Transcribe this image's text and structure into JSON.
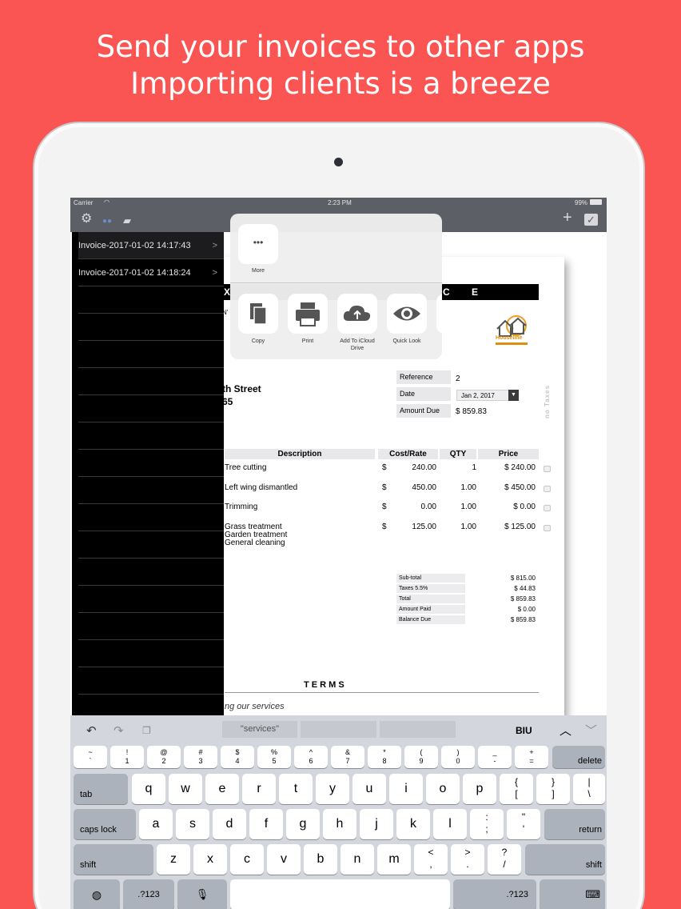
{
  "headline": {
    "line1": "Send your invoices to other apps",
    "line2": "Importing clients is a breeze"
  },
  "status": {
    "carrier": "Carrier",
    "time": "2:23 PM",
    "battery": "99%"
  },
  "nav": {
    "add": "+",
    "done": "✓"
  },
  "invoices": [
    {
      "label": "Invoice-2017-01-02 14:17:43",
      "chev": ">"
    },
    {
      "label": "Invoice-2017-01-02 14:18:24",
      "chev": ">"
    }
  ],
  "share": {
    "more_dots": "•••",
    "more": "More",
    "copy": "Copy",
    "print": "Print",
    "icloud_l1": "Add To iCloud",
    "icloud_l2": "Drive",
    "quicklook": "Quick Look"
  },
  "doc": {
    "bar_left": "X",
    "bar_right": "C E",
    "frag_n": "N'",
    "street": "th Street",
    "zip": "65",
    "logo_text": "Houseline",
    "reference_label": "Reference",
    "reference_value": "2",
    "date_label": "Date",
    "date_value": "Jan 2, 2017",
    "due_label": "Amount Due",
    "due_value": "$ 859.83",
    "vertical": "no Taxes",
    "headers": {
      "description": "Description",
      "cost": "Cost/Rate",
      "qty": "QTY",
      "price": "Price"
    },
    "items": [
      {
        "desc": "Tree cutting",
        "currency": "$",
        "cost": "240.00",
        "qty": "1",
        "price": "$ 240.00"
      },
      {
        "desc": "Left wing dismantled",
        "currency": "$",
        "cost": "450.00",
        "qty": "1.00",
        "price": "$ 450.00"
      },
      {
        "desc": "Trimming",
        "currency": "$",
        "cost": "0.00",
        "qty": "1.00",
        "price": "$ 0.00"
      },
      {
        "desc": "Grass treatment",
        "desc2": "Garden treatment",
        "desc3": "General cleaning",
        "currency": "$",
        "cost": "125.00",
        "qty": "1.00",
        "price": "$ 125.00"
      }
    ],
    "totals": [
      {
        "label": "Sub-total",
        "value": "$ 815.00"
      },
      {
        "label": "Taxes 5.5%",
        "value": "$ 44.83"
      },
      {
        "label": "Total",
        "value": "$ 859.83"
      },
      {
        "label": "Amount Paid",
        "value": "$ 0.00"
      },
      {
        "label": "Balance Due",
        "value": "$ 859.83"
      }
    ],
    "terms": "T E R M S",
    "terms_text": "ng our services"
  },
  "keyboard": {
    "suggestion": "\"services\"",
    "biu": "BIU",
    "row_num": [
      {
        "top": "~",
        "bottom": "`"
      },
      {
        "top": "!",
        "bottom": "1"
      },
      {
        "top": "@",
        "bottom": "2"
      },
      {
        "top": "#",
        "bottom": "3"
      },
      {
        "top": "$",
        "bottom": "4"
      },
      {
        "top": "%",
        "bottom": "5"
      },
      {
        "top": "^",
        "bottom": "6"
      },
      {
        "top": "&",
        "bottom": "7"
      },
      {
        "top": "*",
        "bottom": "8"
      },
      {
        "top": "(",
        "bottom": "9"
      },
      {
        "top": ")",
        "bottom": "0"
      },
      {
        "top": "_",
        "bottom": "-"
      },
      {
        "top": "+",
        "bottom": "="
      }
    ],
    "delete": "delete",
    "tab": "tab",
    "row_q": [
      "q",
      "w",
      "e",
      "r",
      "t",
      "y",
      "u",
      "i",
      "o",
      "p"
    ],
    "row_q_extra": [
      {
        "top": "{",
        "bottom": "["
      },
      {
        "top": "}",
        "bottom": "]"
      },
      {
        "top": "|",
        "bottom": "\\"
      }
    ],
    "caps": "caps lock",
    "row_a": [
      "a",
      "s",
      "d",
      "f",
      "g",
      "h",
      "j",
      "k",
      "l"
    ],
    "row_a_extra": [
      {
        "top": ":",
        "bottom": ";"
      },
      {
        "top": "\"",
        "bottom": "'"
      }
    ],
    "return": "return",
    "shift": "shift",
    "row_z": [
      "z",
      "x",
      "c",
      "v",
      "b",
      "n",
      "m"
    ],
    "row_z_extra": [
      {
        "top": "<",
        "bottom": ","
      },
      {
        "top": ">",
        "bottom": "."
      },
      {
        "top": "?",
        "bottom": "/"
      }
    ],
    "numkey": ".?123"
  }
}
